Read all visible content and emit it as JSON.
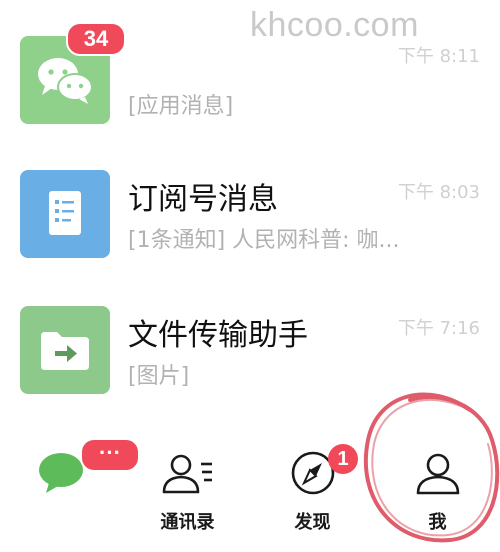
{
  "watermark": "khcoo.com",
  "chats": [
    {
      "title": "",
      "preview": "[应用消息]",
      "time": "下午 8:11",
      "badge": "34",
      "avatar_color": "#8fd08a",
      "avatar_icon": "wechat-bubbles-icon"
    },
    {
      "title": "订阅号消息",
      "preview": "[1条通知] 人民网科普: 咖...",
      "time": "下午 8:03",
      "avatar_color": "#6aaee6",
      "avatar_icon": "document-icon"
    },
    {
      "title": "文件传输助手",
      "preview": "[图片]",
      "time": "下午 7:16",
      "avatar_color": "#8dc98b",
      "avatar_icon": "folder-arrow-icon"
    }
  ],
  "tabbar": {
    "tabs": [
      {
        "label": "",
        "icon": "chat-bubble-icon",
        "badge": "···"
      },
      {
        "label": "通讯录",
        "icon": "contacts-icon"
      },
      {
        "label": "发现",
        "icon": "compass-icon",
        "badge": "1"
      },
      {
        "label": "我",
        "icon": "profile-icon"
      }
    ]
  },
  "colors": {
    "badge": "#f04a5a",
    "wechat_green": "#5dbb5a",
    "annotation_circle": "#d94050"
  }
}
